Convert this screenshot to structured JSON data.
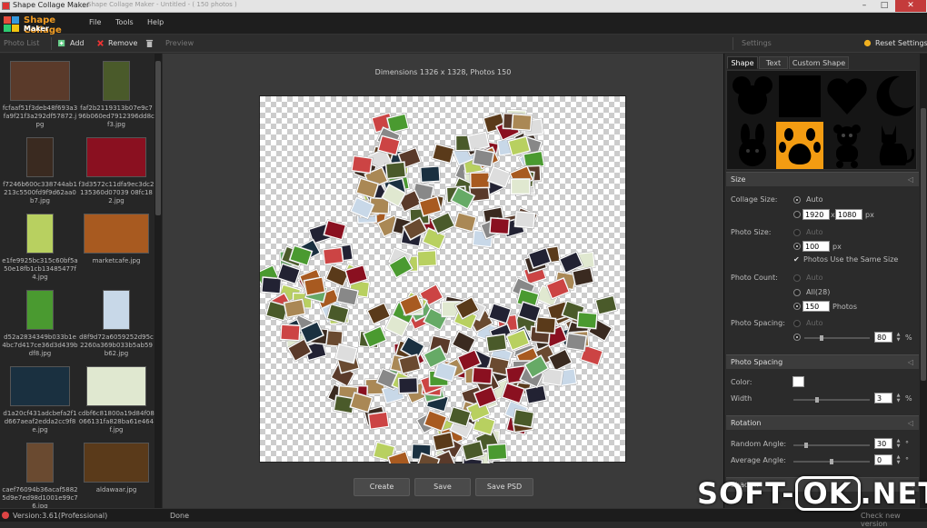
{
  "window": {
    "title": "Shape Collage Maker",
    "subtitle": "Shape Collage Maker  -  Untitled  -  ( 150 photos )",
    "minimize_glyph": "–",
    "maximize_glyph": "□",
    "close_glyph": "✕"
  },
  "logo": {
    "line1": "Shape Collage",
    "line2": "Maker"
  },
  "menu": {
    "file": "File",
    "tools": "Tools",
    "help": "Help"
  },
  "toolbar": {
    "photo_list": "Photo List",
    "add": "Add",
    "remove": "Remove",
    "preview": "Preview",
    "settings": "Settings",
    "reset_settings": "Reset Settings"
  },
  "photos": [
    {
      "name": "fcfaaf51f3deb48f693a3fa9f21f3a292df57872.jpg",
      "color": "#5a3a2a"
    },
    {
      "name": "faf2b2119313b07e9c796b060ed7912396dd8cf3.jpg",
      "color": "#4a5a2a"
    },
    {
      "name": "f7246b600c338744ab1213c5500fd9f9d62aa0b7.jpg",
      "color": "#3a2a20"
    },
    {
      "name": "f3d3572c11dfa9ec3dc2135360d07039 08fc182.jpg",
      "color": "#8a1020"
    },
    {
      "name": "e1fe9925bc315c60bf5a50e18fb1cb13485477f4.jpg",
      "color": "#b8d060"
    },
    {
      "name": "marketcafe.jpg",
      "color": "#a85a20"
    },
    {
      "name": "d52a2834349b033b1e4bc7d417ce36d3d439bdf8.jpg",
      "color": "#4a9a30"
    },
    {
      "name": "d8f9d72a6059252d95c2260a369b033b5ab59b62.jpg",
      "color": "#c8d8e8"
    },
    {
      "name": "d1a20cf431adcbefa2f1d667aeaf2edda2cc9f8e.jpg",
      "color": "#1a3040"
    },
    {
      "name": "cdbf6c81800a19d84f08066131fa828ba61e464f.jpg",
      "color": "#e0e8d0"
    },
    {
      "name": "caef76094b36acaf58825d9e7ed98d1001e99c76.jpg",
      "color": "#6a4a30"
    },
    {
      "name": "aldawaar.jpg",
      "color": "#5a3a1a"
    }
  ],
  "canvas": {
    "dimensions_text": "Dimensions 1326 x 1328, Photos 150"
  },
  "actions": {
    "create": "Create",
    "save": "Save",
    "save_psd": "Save PSD"
  },
  "right_panel": {
    "tabs": [
      "Shape",
      "Text",
      "Custom Shape"
    ],
    "shapes": [
      "mouse-shape",
      "square-shape",
      "heart-shape",
      "moon-shape",
      "rabbit-shape",
      "paw-shape",
      "bear-shape",
      "cat-shape"
    ],
    "selected_shape": "paw-shape",
    "accent_color": "#f39c12",
    "size_section": {
      "header": "Size",
      "collage_size_label": "Collage Size:",
      "auto": "Auto",
      "width": "1920",
      "x": "x",
      "height": "1080",
      "px": "px",
      "photo_size_label": "Photo Size:",
      "photo_size_auto": "Auto",
      "photo_size_value": "100",
      "photo_size_px": "px",
      "same_size": "Photos Use the Same Size",
      "photo_count_label": "Photo Count:",
      "count_auto": "Auto",
      "count_all": "All(28)",
      "count_value": "150",
      "count_unit": "Photos",
      "photo_spacing_label": "Photo Spacing:",
      "spacing_auto": "Auto",
      "spacing_value": "80",
      "spacing_unit": "%",
      "spacing_level": 0.25
    },
    "spacing_section": {
      "header": "Photo Spacing",
      "color_label": "Color:",
      "width_label": "Width",
      "width_value": "3",
      "width_unit": "%",
      "width_level": 0.3
    },
    "rotation_section": {
      "header": "Rotation",
      "random_label": "Random Angle:",
      "random_value": "30",
      "random_unit": "°",
      "random_level": 0.15,
      "average_label": "Average Angle:",
      "average_value": "0",
      "average_unit": "°",
      "average_level": 0.5
    },
    "shadow_section": {
      "header": "Shadow"
    }
  },
  "status": {
    "version": "Version:3.61(Professional)",
    "state": "Done",
    "check_new": "Check new version"
  },
  "watermark": {
    "left": "SOFT-",
    "box": "OK",
    "right": ".NET"
  }
}
